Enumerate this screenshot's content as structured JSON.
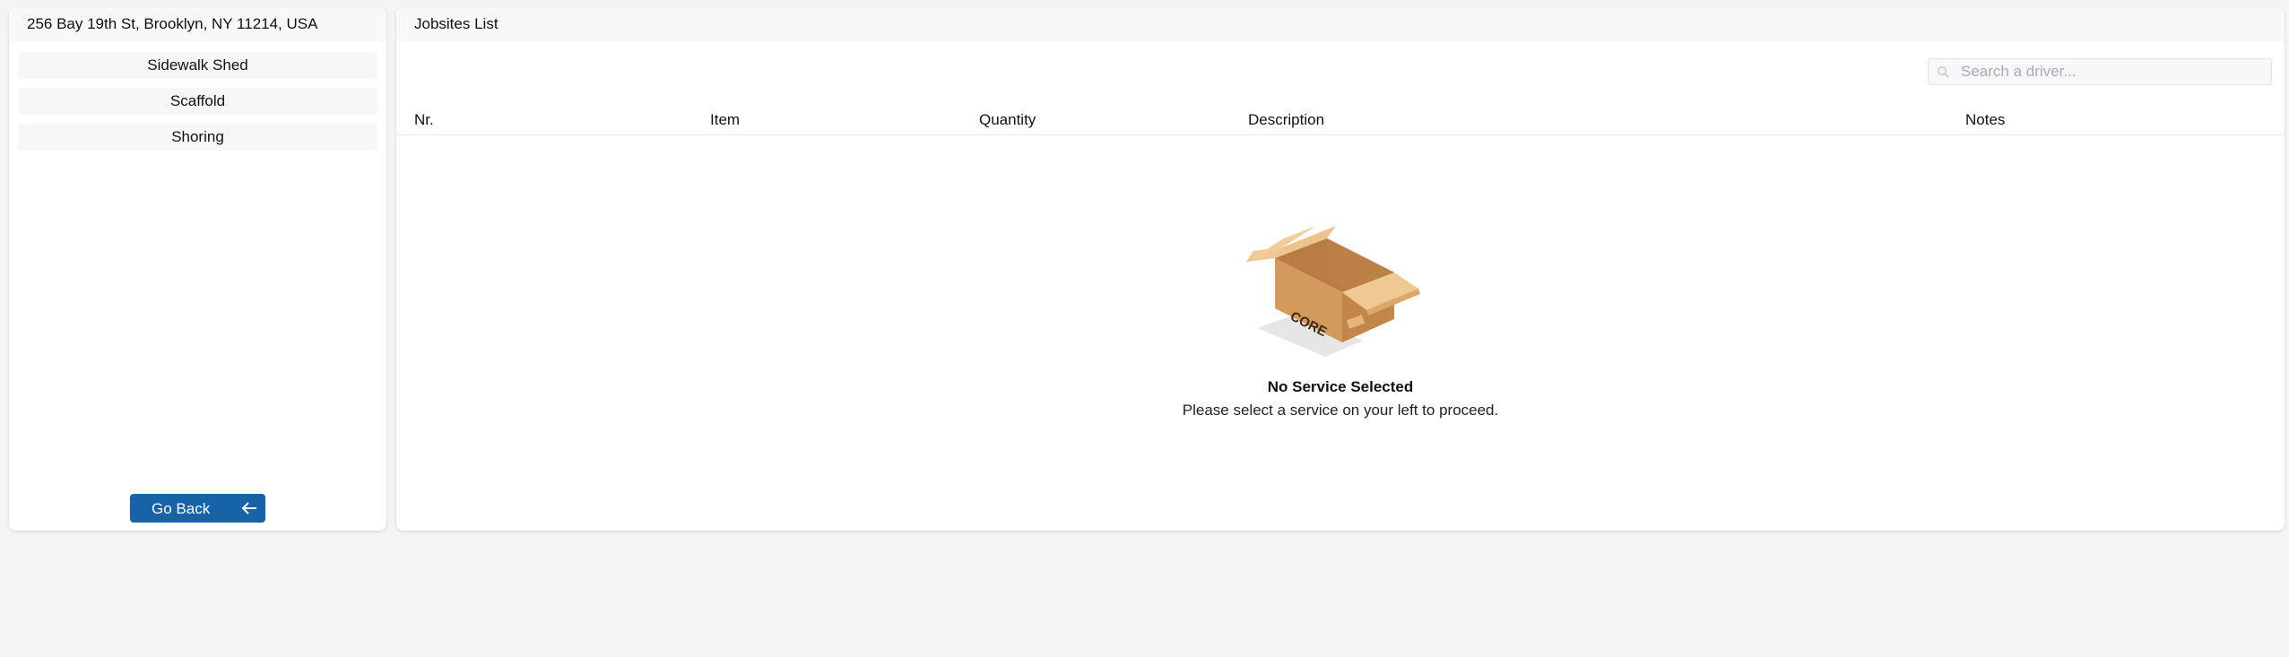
{
  "sidebar": {
    "address": "256 Bay 19th St, Brooklyn, NY 11214, USA",
    "services": [
      {
        "label": "Sidewalk Shed"
      },
      {
        "label": "Scaffold"
      },
      {
        "label": "Shoring"
      }
    ],
    "back_button": {
      "label": "Go Back",
      "icon": "arrow-left-icon"
    }
  },
  "main": {
    "title": "Jobsites List",
    "search": {
      "placeholder": "Search a driver...",
      "value": ""
    },
    "columns": {
      "nr": "Nr.",
      "item": "Item",
      "quantity": "Quantity",
      "description": "Description",
      "notes": "Notes"
    },
    "empty_state": {
      "title": "No Service Selected",
      "message": "Please select a service on your left to proceed.",
      "box_label": "CORE"
    }
  },
  "colors": {
    "accent": "#1763a8",
    "page_background": "#f3f4f6",
    "header_background": "#f7f8fa"
  }
}
